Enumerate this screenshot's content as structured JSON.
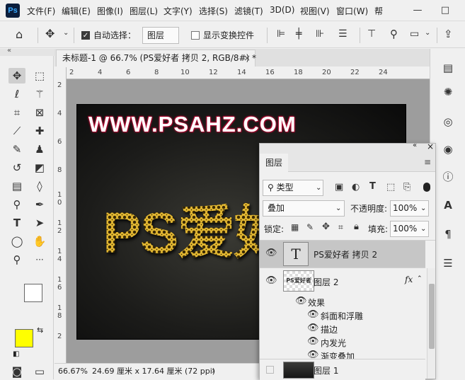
{
  "menubar": {
    "app_logo": "Ps",
    "items": [
      "文件(F)",
      "编辑(E)",
      "图像(I)",
      "图层(L)",
      "文字(Y)",
      "选择(S)",
      "滤镜(T)",
      "3D(D)",
      "视图(V)",
      "窗口(W)",
      "帮"
    ],
    "window_buttons": [
      "—",
      "□"
    ]
  },
  "options_bar": {
    "auto_select_label": "自动选择：",
    "auto_select_checked": true,
    "target_select": "图层",
    "transform_controls_label": "显示变换控件",
    "transform_controls_checked": false
  },
  "document": {
    "tab_title": "未标题-1 @ 66.7% (PS爱好者 拷贝 2, RGB/8#) *",
    "tab_close": "×",
    "ruler_top_labels": [
      "2",
      "4",
      "6",
      "8",
      "10",
      "12",
      "14",
      "16",
      "18",
      "20",
      "22",
      "24"
    ],
    "ruler_left_labels": [
      "2",
      "4",
      "6",
      "8",
      "1",
      "0",
      "1",
      "2",
      "1",
      "4",
      "1",
      "6",
      "1",
      "8",
      "2"
    ],
    "canvas_site_text": "WWW.PSAHZ.COM",
    "canvas_gold_text": "PS爱好",
    "zoom_level": "66.67%",
    "doc_size": "24.69 厘米 x 17.64 厘米 (72 ppi)",
    "status_arrow": "›"
  },
  "colors": {
    "foreground": "#ffff00",
    "background": "#ffffff",
    "selected_layer": "#c6c6c6"
  },
  "layers_panel": {
    "tab_label": "图层",
    "collapse_icon": "«",
    "close_icon": "×",
    "menu_icon": "≡",
    "filter_kind": "类型",
    "blend_mode": "叠加",
    "opacity_label": "不透明度:",
    "opacity_value": "100%",
    "lock_label": "锁定:",
    "fill_label": "填充:",
    "fill_value": "100%",
    "layers": [
      {
        "name": "PS爱好者 拷贝 2",
        "type": "text",
        "visible": true,
        "selected": true
      },
      {
        "name": "图层 2",
        "type": "pixel",
        "visible": true,
        "selected": false,
        "fx": "fx",
        "thumb_text": "PS爱好者"
      },
      {
        "name": "图层 1",
        "type": "pixel",
        "visible": false,
        "selected": false
      }
    ],
    "effects_label": "效果",
    "effects": [
      "斜面和浮雕",
      "描边",
      "内发光",
      "渐变叠加"
    ]
  }
}
